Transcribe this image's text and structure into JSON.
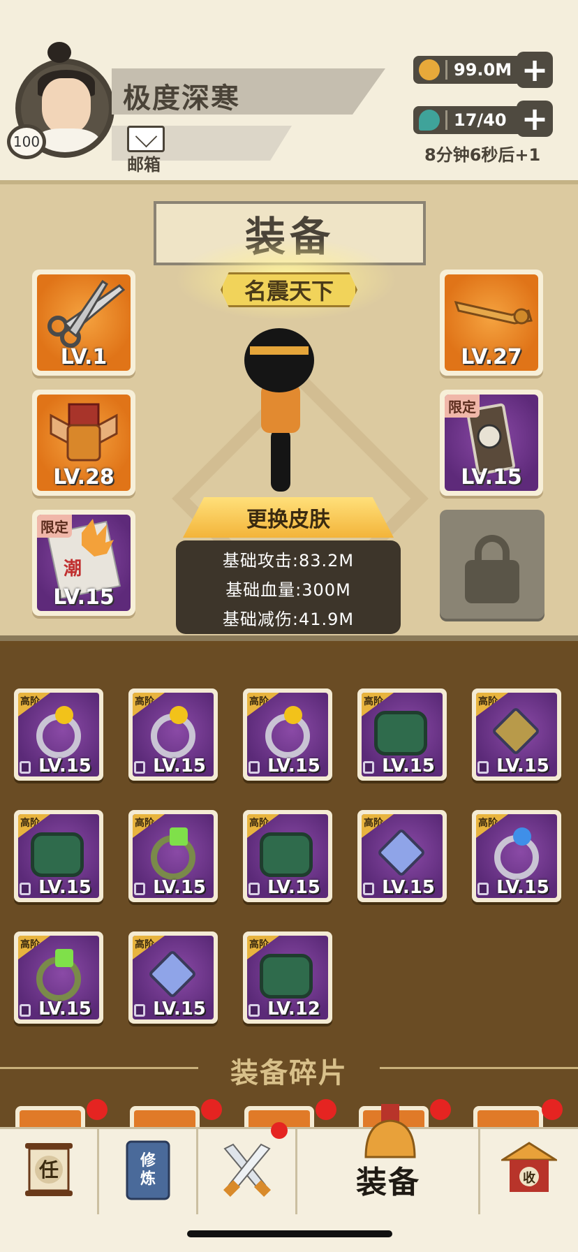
{
  "player": {
    "name": "极度深寒",
    "level": "100",
    "mail_label": "邮箱"
  },
  "resources": {
    "coins": "99.0M",
    "energy": "17/40",
    "timer": "8分钟6秒后+1",
    "coin_color": "#e8a93a",
    "energy_color": "#3fa39a"
  },
  "panel": {
    "title": "装备",
    "rank": "名震天下",
    "skin_button": "更换皮肤"
  },
  "stats": [
    "基础攻击:83.2M",
    "基础血量:300M",
    "基础减伤:41.9M"
  ],
  "equipped": {
    "left": [
      {
        "icon": "scissors-icon",
        "level": "LV.1",
        "bg": "orange",
        "tag": ""
      },
      {
        "icon": "armor-icon",
        "level": "LV.28",
        "bg": "orange",
        "tag": ""
      },
      {
        "icon": "book-icon",
        "level": "LV.15",
        "bg": "purple",
        "tag": "限定"
      }
    ],
    "right": [
      {
        "icon": "key-icon",
        "level": "LV.27",
        "bg": "orange",
        "tag": ""
      },
      {
        "icon": "scroll-icon",
        "level": "LV.15",
        "bg": "purple",
        "tag": "限定"
      }
    ]
  },
  "inventory": {
    "tier_label": "高阶",
    "items": [
      {
        "icon": "ring-icon",
        "gem": "#f2c21a",
        "level": "LV.15"
      },
      {
        "icon": "ring-icon",
        "gem": "#f2c21a",
        "level": "LV.15"
      },
      {
        "icon": "ring-icon",
        "gem": "#f2c21a",
        "level": "LV.15"
      },
      {
        "icon": "bracer-icon",
        "gem": "",
        "level": "LV.15"
      },
      {
        "icon": "necklace-icon",
        "gem": "#b89a4a",
        "level": "LV.15"
      },
      {
        "icon": "bracer-icon",
        "gem": "",
        "level": "LV.15"
      },
      {
        "icon": "bracelet-icon",
        "gem": "#7fe04a",
        "level": "LV.15"
      },
      {
        "icon": "bracer-icon",
        "gem": "",
        "level": "LV.15"
      },
      {
        "icon": "necklace-icon",
        "gem": "#8fa4e8",
        "level": "LV.15"
      },
      {
        "icon": "ring-icon",
        "gem": "#3f8fe8",
        "level": "LV.15"
      },
      {
        "icon": "bracelet-icon",
        "gem": "#7fe04a",
        "level": "LV.15"
      },
      {
        "icon": "necklace-icon",
        "gem": "#8fa4e8",
        "level": "LV.15"
      },
      {
        "icon": "bracer-icon",
        "gem": "",
        "level": "LV.12"
      }
    ]
  },
  "fragments": {
    "title": "装备碎片"
  },
  "nav": {
    "tabs": [
      {
        "icon": "task-scroll-icon",
        "text": "任"
      },
      {
        "icon": "cultivate-book-icon",
        "text": "修炼"
      },
      {
        "icon": "crossed-swords-icon",
        "text": ""
      },
      {
        "icon": "equipment-helmet-icon",
        "text": ""
      },
      {
        "icon": "shop-pavilion-icon",
        "text": "收"
      }
    ],
    "active_label": "装备"
  }
}
